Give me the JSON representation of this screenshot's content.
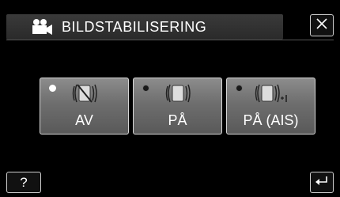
{
  "header": {
    "title": "BILDSTABILISERING",
    "mode_icon": "video-camera-icon"
  },
  "close_button": {
    "icon": "close-icon"
  },
  "options": [
    {
      "label": "AV",
      "icon": "stabilizer-off-icon",
      "selected": true
    },
    {
      "label": "PÅ",
      "icon": "stabilizer-on-icon",
      "selected": false
    },
    {
      "label": "PÅ (AIS)",
      "icon": "stabilizer-ais-icon",
      "selected": false
    }
  ],
  "help_button": {
    "label": "?",
    "icon": "help-icon"
  },
  "back_button": {
    "icon": "back-arrow-icon"
  }
}
